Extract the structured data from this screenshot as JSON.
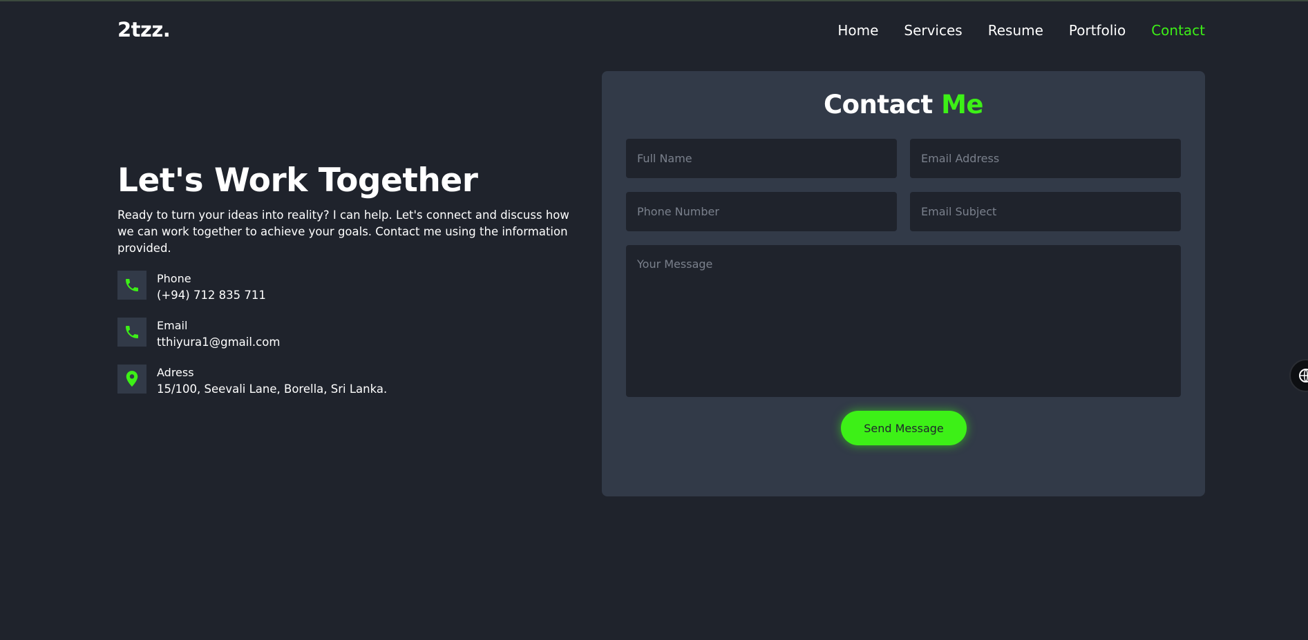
{
  "header": {
    "logo": "2tzz.",
    "nav": [
      "Home",
      "Services",
      "Resume",
      "Portfolio",
      "Contact"
    ]
  },
  "intro": {
    "title": "Let's Work Together",
    "text": "Ready to turn your ideas into reality? I can help. Let's connect and discuss how we can work together to achieve your goals. Contact me using the information provided."
  },
  "contact_info": [
    {
      "icon": "phone-icon",
      "label": "Phone",
      "value": "(+94) 712 835 711"
    },
    {
      "icon": "phone-icon",
      "label": "Email",
      "value": "tthiyura1@gmail.com"
    },
    {
      "icon": "location-pin-icon",
      "label": "Adress",
      "value": "15/100, Seevali Lane, Borella, Sri Lanka."
    }
  ],
  "form": {
    "title": "Contact",
    "title_accent": "Me",
    "full_name_placeholder": "Full Name",
    "email_placeholder": "Email Address",
    "phone_placeholder": "Phone Number",
    "subject_placeholder": "Email Subject",
    "message_placeholder": "Your Message",
    "submit_label": "Send Message"
  },
  "colors": {
    "background": "#1f232c",
    "card": "#323a48",
    "accent": "#3df017",
    "text": "#ffffff"
  }
}
